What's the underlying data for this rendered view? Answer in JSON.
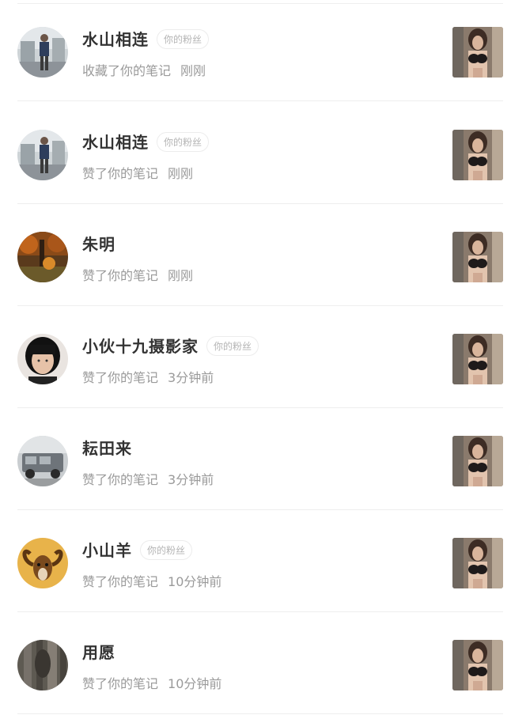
{
  "notifications": [
    {
      "name": "水山相连",
      "badge": "你的粉丝",
      "action": "收藏了你的笔记",
      "time": "刚刚",
      "avatar_icon": "man-standing-outdoor-avatar",
      "thumb_icon": "note-thumbnail"
    },
    {
      "name": "水山相连",
      "badge": "你的粉丝",
      "action": "赞了你的笔记",
      "time": "刚刚",
      "avatar_icon": "man-standing-outdoor-avatar",
      "thumb_icon": "note-thumbnail"
    },
    {
      "name": "朱明",
      "badge": "",
      "action": "赞了你的笔记",
      "time": "刚刚",
      "avatar_icon": "autumn-forest-avatar",
      "thumb_icon": "note-thumbnail"
    },
    {
      "name": "小伙十九摄影家",
      "badge": "你的粉丝",
      "action": "赞了你的笔记",
      "time": "3分钟前",
      "avatar_icon": "portrait-face-avatar",
      "thumb_icon": "note-thumbnail"
    },
    {
      "name": "耘田来",
      "badge": "",
      "action": "赞了你的笔记",
      "time": "3分钟前",
      "avatar_icon": "truck-avatar",
      "thumb_icon": "note-thumbnail"
    },
    {
      "name": "小山羊",
      "badge": "你的粉丝",
      "action": "赞了你的笔记",
      "time": "10分钟前",
      "avatar_icon": "goat-horns-avatar",
      "thumb_icon": "note-thumbnail"
    },
    {
      "name": "用愿",
      "badge": "",
      "action": "赞了你的笔记",
      "time": "10分钟前",
      "avatar_icon": "tree-bark-avatar",
      "thumb_icon": "note-thumbnail"
    }
  ]
}
